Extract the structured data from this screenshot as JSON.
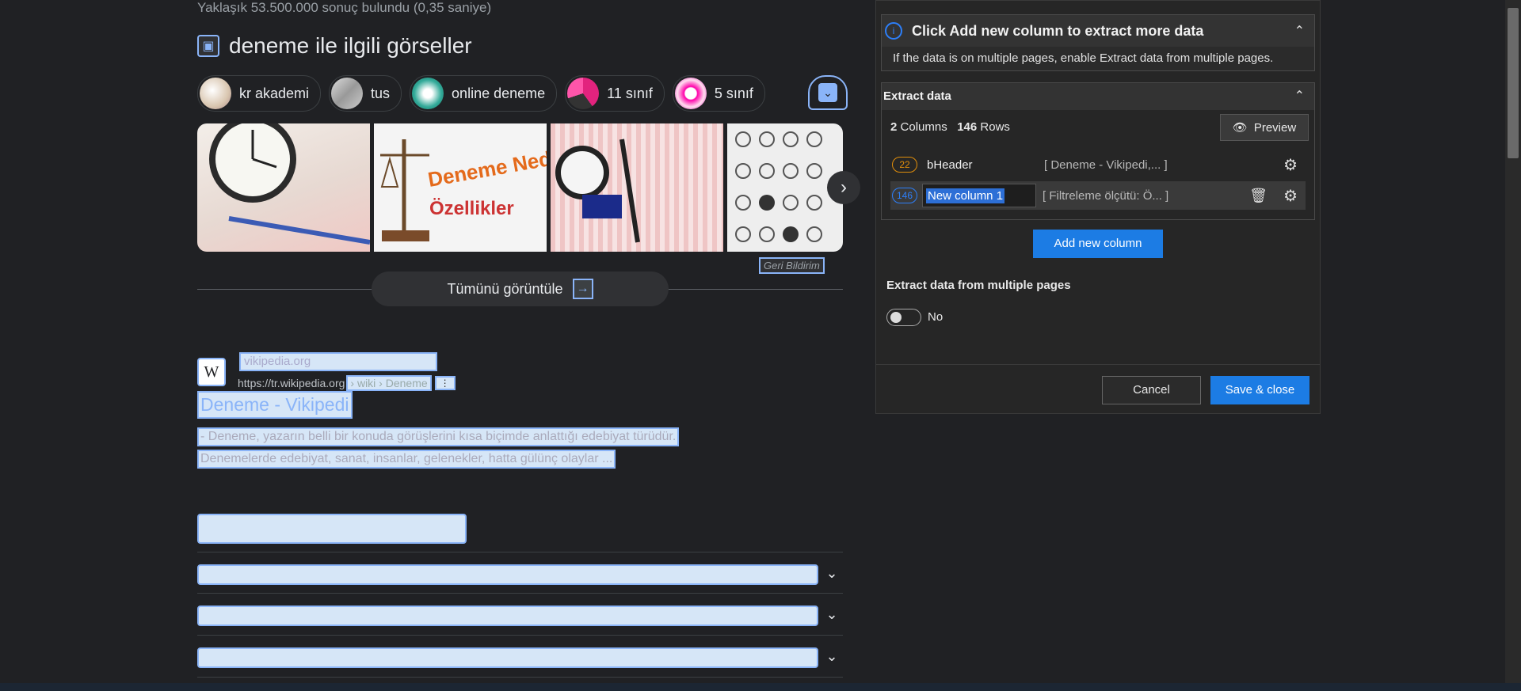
{
  "results": {
    "count_text": "Yaklaşık 53.500.000 sonuç bulundu (0,35 saniye)",
    "images_title": "deneme ile ilgili görseller",
    "chips": [
      {
        "label": "kr akademi"
      },
      {
        "label": "tus"
      },
      {
        "label": "online deneme"
      },
      {
        "label": "11 sınıf"
      },
      {
        "label": "5 sınıf"
      }
    ],
    "gallery_texts": {
      "deneme_ned": "Deneme Ned",
      "ozellikler": "Özellikler"
    },
    "feedback": "Geri Bildirim",
    "view_all": "Tümünü görüntüle",
    "wiki": {
      "favicon": "W",
      "site_name": "vikipedia.org",
      "url": "https://tr.wikipedia.org",
      "url_path": "› wiki › Deneme",
      "more": "⋮",
      "title": "Deneme - Vikipedi",
      "snippet_line1": "- Deneme, yazarın belli bir konuda görüşlerini kısa biçimde anlattığı edebiyat türüdür.",
      "snippet_line2": "Denemelerde edebiyat, sanat, insanlar, gelenekler, hatta gülünç olaylar ..."
    }
  },
  "panel": {
    "info_title": "Click Add new column to extract more data",
    "info_body": "If the data is on multiple pages, enable Extract data from multiple pages.",
    "extract_title": "Extract data",
    "columns_count": "2",
    "columns_label": "Columns",
    "rows_count": "146",
    "rows_label": "Rows",
    "preview": "Preview",
    "columns": [
      {
        "badge": "22",
        "name": "bHeader",
        "sample": "[ Deneme - Vikipedi,...  ]"
      },
      {
        "badge": "146",
        "name": "New column 1",
        "sample": "[ Filtreleme ölçütü: Ö...  ]"
      }
    ],
    "add_column": "Add new column",
    "multi_pages_label": "Extract data from multiple pages",
    "toggle_value": "No",
    "cancel": "Cancel",
    "save_close": "Save & close"
  },
  "colors": {
    "accent": "#1c7ce4",
    "link": "#8ab4f8",
    "highlight_border": "#8ab4f8",
    "badge_orange": "#e08e0b"
  }
}
